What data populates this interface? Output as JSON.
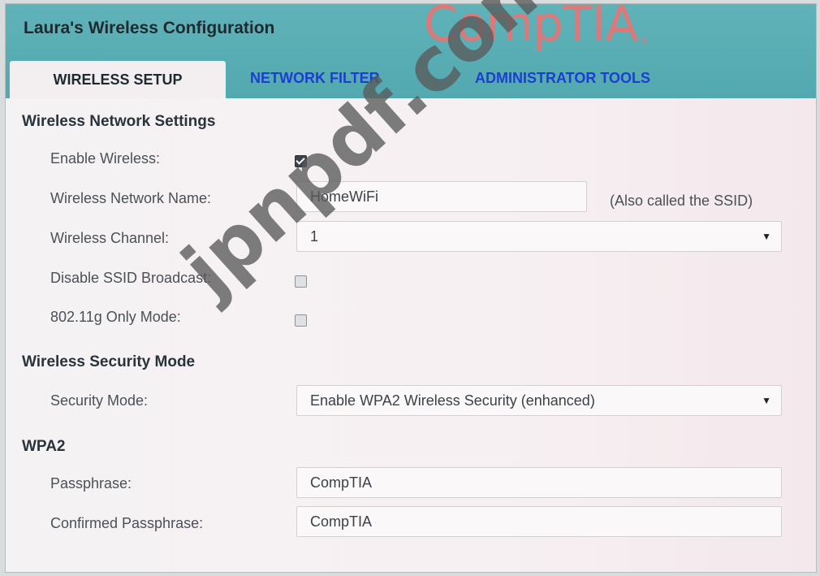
{
  "window": {
    "title": "Laura's Wireless Configuration",
    "brand_logo": "CompTIA",
    "brand_mark": "®"
  },
  "tabs": [
    {
      "label": "WIRELESS SETUP",
      "active": true
    },
    {
      "label": "NETWORK FILTER",
      "active": false
    },
    {
      "label": "ADMINISTRATOR TOOLS",
      "active": false
    }
  ],
  "wireless_network_settings": {
    "title": "Wireless Network Settings",
    "enable_wireless": {
      "label": "Enable Wireless:",
      "checked": true
    },
    "network_name": {
      "label": "Wireless Network Name:",
      "value": "HomeWiFi",
      "hint": "(Also called the SSID)"
    },
    "channel": {
      "label": "Wireless Channel:",
      "value": "1"
    },
    "disable_ssid_broadcast": {
      "label": "Disable SSID Broadcast:",
      "checked": false
    },
    "g_only_mode": {
      "label": "802.11g Only Mode:",
      "checked": false
    }
  },
  "wireless_security_mode": {
    "title": "Wireless Security Mode",
    "security_mode": {
      "label": "Security Mode:",
      "value": "Enable WPA2 Wireless Security (enhanced)"
    }
  },
  "wpa2": {
    "title": "WPA2",
    "passphrase": {
      "label": "Passphrase:",
      "value": "CompTIA"
    },
    "confirmed_passphrase": {
      "label": "Confirmed Passphrase:",
      "value": "CompTIA"
    }
  },
  "watermark": "jpnpdf.com",
  "colors": {
    "header_bg": "#5fb2b8",
    "tab_link": "#1c3fd3",
    "brand": "#e97474"
  }
}
